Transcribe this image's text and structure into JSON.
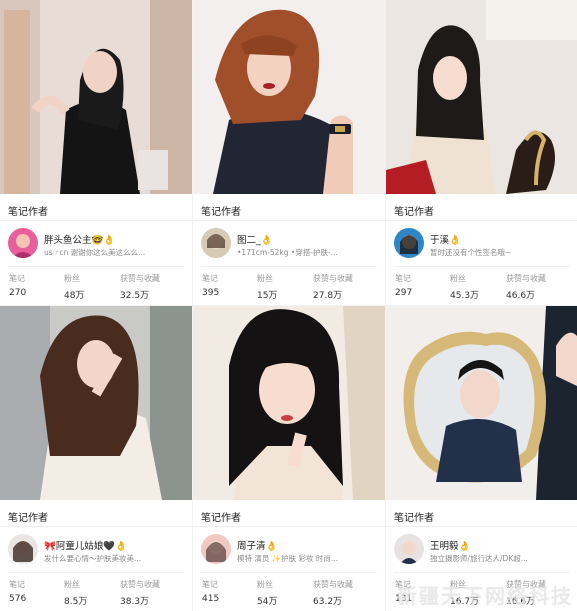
{
  "section_title": "笔记作者",
  "stat_labels": {
    "notes": "笔记",
    "fans": "粉丝",
    "likes": "获赞与收藏"
  },
  "cards": [
    {
      "name": "胖头鱼公主🤓👌",
      "bio": "us☞cn 谢谢你这么美这么么...",
      "notes": "270",
      "fans": "48万",
      "likes": "32.5万"
    },
    {
      "name": "图二_👌",
      "bio": "•171cm-52kg •穿搭-护肤-...",
      "notes": "395",
      "fans": "15万",
      "likes": "27.8万"
    },
    {
      "name": "于溪👌",
      "bio": "暂时还没有个性签名哦~",
      "notes": "297",
      "fans": "45.3万",
      "likes": "46.6万"
    },
    {
      "name": "🎀阿童儿姑娘🖤👌",
      "bio": "发什么要心情～护肤美妆美...",
      "notes": "576",
      "fans": "8.5万",
      "likes": "38.3万"
    },
    {
      "name": "周子清👌",
      "bio": "模特 演员 ✨护肤 彩妆 时尚...",
      "notes": "415",
      "fans": "54万",
      "likes": "63.2万"
    },
    {
      "name": "王明毅👌",
      "bio": "独立摄影师/旅行达人/DK超...",
      "notes": "131",
      "fans": "16.7万",
      "likes": "16.6万"
    }
  ],
  "watermark": "新疆天下网络科技"
}
